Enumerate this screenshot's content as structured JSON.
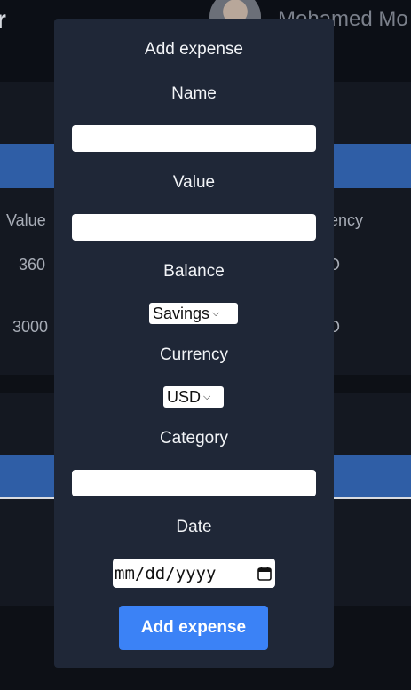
{
  "background": {
    "brand_fragment": "r",
    "user_name": "Mohamed Mo",
    "table_headers": {
      "value": "Value",
      "currency": "ency"
    },
    "rows": [
      {
        "value": "360",
        "currency": "D"
      },
      {
        "value": "3000",
        "currency": "D"
      }
    ]
  },
  "modal": {
    "title": "Add expense",
    "name_label": "Name",
    "name_value": "",
    "value_label": "Value",
    "value_value": "",
    "balance_label": "Balance",
    "balance_selected": "Savings",
    "currency_label": "Currency",
    "currency_selected": "USD",
    "category_label": "Category",
    "category_value": "",
    "date_label": "Date",
    "date_placeholder": "mm/dd/yyyy",
    "submit_label": "Add expense"
  },
  "colors": {
    "modal_bg": "#1f2737",
    "accent": "#3b82f6",
    "table_header_bar": "#2f5ea6"
  }
}
